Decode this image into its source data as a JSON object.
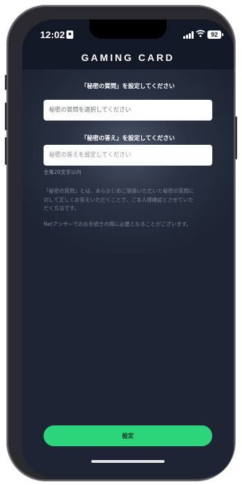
{
  "status": {
    "time": "12:02",
    "battery": "92"
  },
  "header": {
    "title": "GAMING CARD"
  },
  "question": {
    "label": "「秘密の質問」を設定してください",
    "placeholder": "秘密の質問を選択してください"
  },
  "answer": {
    "label": "「秘密の答え」を設定してください",
    "placeholder": "秘密の答えを設定してください",
    "hint": "全角20文字以内"
  },
  "description": {
    "line1": "「秘密の質問」とは、あらかじめご登録いただいた秘密の質問に",
    "line2": "対して正しくお答えいただくことで、ご本人様確認とさせていた",
    "line3": "だく方法です。",
    "line4": "Netアンサーでのお手続きの際に必要となることがございます。"
  },
  "submit": {
    "label": "設定"
  },
  "colors": {
    "accent": "#2bd67b",
    "background": "#1e2433",
    "header": "#121826"
  },
  "icons": [
    "id-card-icon",
    "signal-icon",
    "wifi-icon",
    "battery-icon"
  ]
}
